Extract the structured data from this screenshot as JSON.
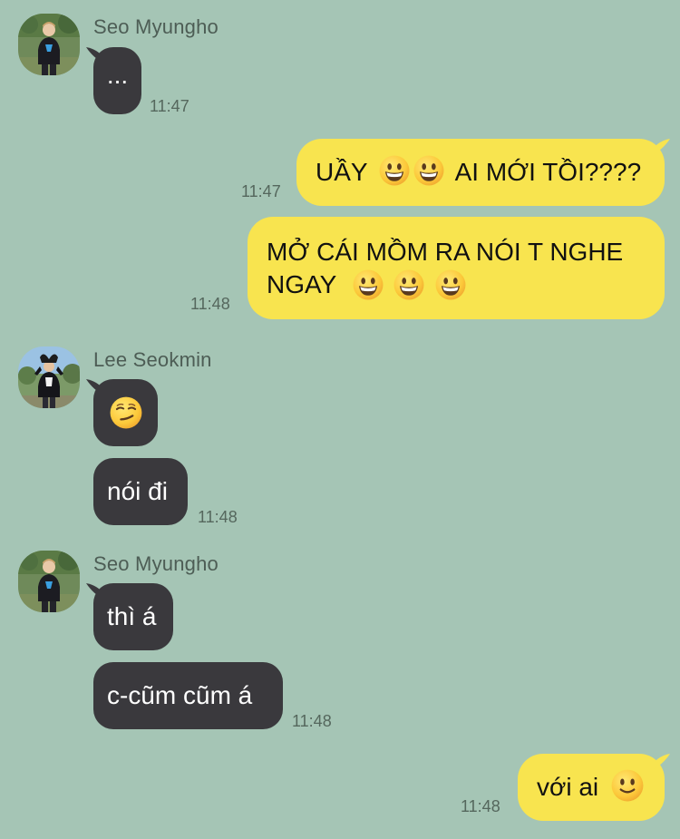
{
  "chat": {
    "messages": [
      {
        "sender": "Seo Myungho",
        "bubbles": [
          {
            "text": "...",
            "time": "11:47"
          }
        ]
      },
      {
        "sender": "me",
        "bubbles": [
          {
            "text": "UẦY",
            "emojis": [
              "grinning-emoji",
              "grinning-emoji"
            ],
            "text_after": "AI MỚI TỒI????",
            "time": "11:47"
          },
          {
            "line1": "MỞ CÁI MỒM RA NÓI T NGHE",
            "line2": "NGAY",
            "emojis": [
              "grinning-emoji",
              "grinning-emoji",
              "grinning-emoji"
            ],
            "time": "11:48"
          }
        ]
      },
      {
        "sender": "Lee Seokmin",
        "bubbles": [
          {
            "emoji": "smirking-emoji"
          },
          {
            "text": "nói đi",
            "time": "11:48"
          }
        ]
      },
      {
        "sender": "Seo Myungho",
        "bubbles": [
          {
            "text": "thì á"
          },
          {
            "text": "c-cũm cũm á",
            "time": "11:48"
          }
        ]
      },
      {
        "sender": "me",
        "bubbles": [
          {
            "text": "với ai",
            "emoji": "slightly-smiling-emoji",
            "time": "11:48"
          }
        ]
      }
    ]
  },
  "colors": {
    "background": "#a5c5b5",
    "incoming_bubble": "#3a393d",
    "outgoing_bubble": "#f8e44f",
    "name_text": "#4d5d55",
    "time_text": "#55675d"
  }
}
